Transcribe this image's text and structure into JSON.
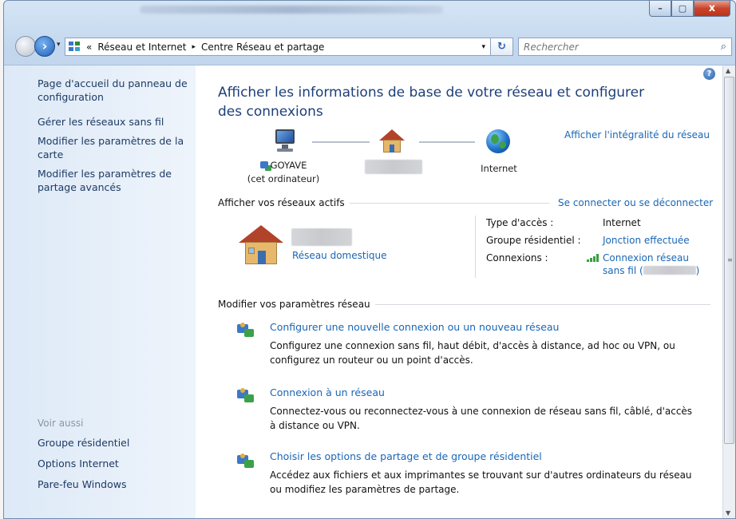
{
  "window": {
    "controls": {
      "minimize": "–",
      "maximize": "▢",
      "close": "x"
    }
  },
  "address_bar": {
    "prefix": "«",
    "crumbs": [
      "Réseau et Internet",
      "Centre Réseau et partage"
    ],
    "separator": "▸",
    "dropdown": "▾",
    "refresh": "↻"
  },
  "search": {
    "placeholder": "Rechercher"
  },
  "sidebar": {
    "links": [
      "Page d'accueil du panneau de configuration",
      "Gérer les réseaux sans fil",
      "Modifier les paramètres de la carte",
      "Modifier les paramètres de partage avancés"
    ],
    "see_also_heading": "Voir aussi",
    "see_also": [
      "Groupe résidentiel",
      "Options Internet",
      "Pare-feu Windows"
    ]
  },
  "main": {
    "title": "Afficher les informations de base de votre réseau et configurer des connexions",
    "full_map_link": "Afficher l'intégralité du réseau",
    "map": {
      "computer_name": "GOYAVE",
      "computer_sub": "(cet ordinateur)",
      "internet": "Internet"
    },
    "active_networks": {
      "heading": "Afficher vos réseaux actifs",
      "connect_link": "Se connecter ou se déconnecter",
      "network_type": "Réseau domestique",
      "props": {
        "access_type_label": "Type d'accès :",
        "access_type_value": "Internet",
        "homegroup_label": "Groupe résidentiel :",
        "homegroup_value": "Jonction effectuée",
        "connections_label": "Connexions :",
        "connection_line1": "Connexion réseau",
        "connection_line2": "sans fil ("
      }
    },
    "change_settings": {
      "heading": "Modifier vos paramètres réseau",
      "tasks": [
        {
          "title": "Configurer une nouvelle connexion ou un nouveau réseau",
          "desc": "Configurez une connexion sans fil, haut débit, d'accès à distance, ad hoc ou VPN, ou configurez un routeur ou un point d'accès."
        },
        {
          "title": "Connexion à un réseau",
          "desc": "Connectez-vous ou reconnectez-vous à une connexion de réseau sans fil, câblé, d'accès à distance ou VPN."
        },
        {
          "title": "Choisir les options de partage et de groupe résidentiel",
          "desc": "Accédez aux fichiers et aux imprimantes se trouvant sur d'autres ordinateurs du réseau ou modifiez les paramètres de partage."
        }
      ]
    }
  },
  "colors": {
    "link": "#1a66b5",
    "title": "#1d3f7a",
    "sidebar_bg": "#dde9f7",
    "close_button": "#c9442a"
  },
  "icons": {
    "back": "back-arrow-icon",
    "forward": "forward-arrow-icon",
    "search": "magnifier-icon",
    "help": "help-icon",
    "computer": "computer-icon",
    "home": "house-icon",
    "internet": "globe-icon",
    "signal": "wifi-signal-icon"
  }
}
